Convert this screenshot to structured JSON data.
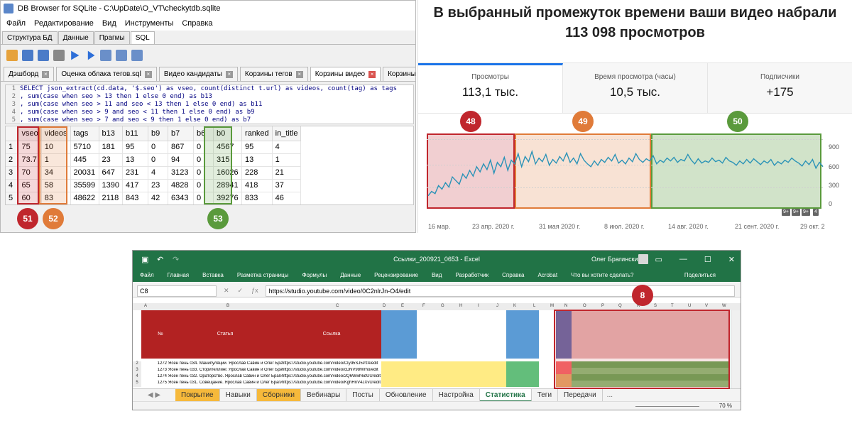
{
  "dbb": {
    "title": "DB Browser for SQLite - C:\\UpDate\\O_VT\\checkytdb.sqlite",
    "menu": [
      "Файл",
      "Редактирование",
      "Вид",
      "Инструменты",
      "Справка"
    ],
    "main_tabs": [
      "Структура БД",
      "Данные",
      "Прагмы",
      "SQL"
    ],
    "active_main_tab": "SQL",
    "sub_tabs": [
      {
        "label": "Дэшборд",
        "x_color": "gray"
      },
      {
        "label": "Оценка облака тегов.sql",
        "x_color": "gray"
      },
      {
        "label": "Видео кандидаты",
        "x_color": "gray"
      },
      {
        "label": "Корзины тегов",
        "x_color": "gray"
      },
      {
        "label": "Корзины видео",
        "x_color": "red"
      },
      {
        "label": "Корзины тегов видео",
        "x_color": "gray"
      }
    ],
    "sql_lines": [
      {
        "n": "1",
        "text": "SELECT json_extract(cd.data, '$.seo') as vseo, count(distinct t.url) as videos, count(tag) as tags"
      },
      {
        "n": "2",
        "text": ", sum(case when seo > 13 then 1 else 0 end) as b13"
      },
      {
        "n": "3",
        "text": ", sum(case when seo > 11 and seo < 13 then 1 else 0 end) as b11"
      },
      {
        "n": "4",
        "text": ", sum(case when seo > 9 and seo < 11 then 1 else 0 end) as b9"
      },
      {
        "n": "5",
        "text": ", sum(case when seo > 7 and seo < 9 then 1 else 0 end) as b7"
      }
    ],
    "grid": {
      "columns": [
        "vseo",
        "videos",
        "tags",
        "b13",
        "b11",
        "b9",
        "b7",
        "b6",
        "b0",
        "ranked",
        "in_title"
      ],
      "rows": [
        [
          "1",
          "75",
          "10",
          "5710",
          "181",
          "95",
          "0",
          "867",
          "0",
          "4567",
          "95",
          "4"
        ],
        [
          "2",
          "73.7",
          "1",
          "445",
          "23",
          "13",
          "0",
          "94",
          "0",
          "315",
          "13",
          "1"
        ],
        [
          "3",
          "70",
          "34",
          "20031",
          "647",
          "231",
          "4",
          "3123",
          "0",
          "16026",
          "228",
          "21"
        ],
        [
          "4",
          "65",
          "58",
          "35599",
          "1390",
          "417",
          "23",
          "4828",
          "0",
          "28941",
          "418",
          "37"
        ],
        [
          "5",
          "60",
          "83",
          "48622",
          "2118",
          "843",
          "42",
          "6343",
          "0",
          "39276",
          "833",
          "46"
        ]
      ]
    },
    "badges": [
      {
        "label": "51",
        "color": "#c0262d"
      },
      {
        "label": "52",
        "color": "#e07b39"
      },
      {
        "label": "53",
        "color": "#5a9a3c"
      }
    ]
  },
  "yt": {
    "headline_1": "В выбранный промежуток времени ваши видео набрали",
    "headline_2": "113 098 просмотров",
    "metrics": [
      {
        "label": "Просмотры",
        "value": "113,1 тыс."
      },
      {
        "label": "Время просмотра (часы)",
        "value": "10,5 тыс."
      },
      {
        "label": "Подписчики",
        "value": "+175"
      }
    ],
    "badges": [
      {
        "label": "48",
        "color": "#c0262d"
      },
      {
        "label": "49",
        "color": "#e07b39"
      },
      {
        "label": "50",
        "color": "#5a9a3c"
      }
    ],
    "chart_data": {
      "type": "line",
      "x": [
        "16 мар.",
        "23 апр. 2020 г.",
        "31 мая 2020 г.",
        "8 июл. 2020 г.",
        "14 авг. 2020 г.",
        "21 сент. 2020 г.",
        "29 окт. 2"
      ],
      "yticks": [
        "900",
        "600",
        "300",
        "0"
      ],
      "ylim": [
        0,
        900
      ],
      "series_color": "#2b93b7",
      "values": [
        120,
        180,
        150,
        260,
        210,
        300,
        240,
        380,
        330,
        280,
        420,
        360,
        470,
        390,
        520,
        450,
        560,
        480,
        610,
        430,
        580,
        520,
        650,
        470,
        610,
        560,
        700,
        520,
        660,
        590,
        730,
        560,
        640,
        590,
        690,
        540,
        620,
        570,
        660,
        600,
        710,
        580,
        640,
        560,
        700,
        610,
        560,
        520,
        600,
        540,
        620,
        580,
        650,
        600,
        690,
        570,
        610,
        560,
        640,
        590,
        700,
        620,
        580,
        630,
        600,
        670,
        560,
        610,
        580,
        640,
        600,
        650,
        580,
        620,
        600,
        690,
        610,
        560,
        630,
        570,
        600,
        580,
        640,
        590,
        610,
        570,
        650,
        600,
        580,
        540,
        600,
        560,
        620,
        570,
        630,
        590,
        550,
        600,
        570,
        620,
        540,
        590,
        560,
        610,
        580,
        640,
        600,
        570,
        530,
        600,
        550,
        620,
        500,
        580,
        520
      ]
    },
    "mini_badges": [
      "9+",
      "9+",
      "9+",
      "4"
    ]
  },
  "xl": {
    "title": "Ссылки_200921_0653 - Excel",
    "user": "Олег Брагинский",
    "ribbon": [
      "Файл",
      "Главная",
      "Вставка",
      "Разметка страницы",
      "Формулы",
      "Данные",
      "Рецензирование",
      "Вид",
      "Разработчик",
      "Справка",
      "Acrobat",
      "Что вы хотите сделать?"
    ],
    "share": "Поделиться",
    "namebox": "C8",
    "formula": "https://studio.youtube.com/video/0C2nlrJn-O4/edit",
    "headers": [
      "№",
      "Статья",
      "Ссылка"
    ],
    "rows": [
      [
        "1272",
        "Ясен пень 034. Манипуляции. Ярослав Савин и Олег Брагинский",
        "https://studio.youtube.com/video/CIyd5SJ5Pz4/edit"
      ],
      [
        "1273",
        "Ясен пень 033. Сторителлинг. Ярослав Савин и Олег Брагинский",
        "https://studio.youtube.com/video/cDNV98Wrho/edit"
      ],
      [
        "1274",
        "Ясен пень 032. Ораторство. Ярослав Савин и Олег Брагинский",
        "https://studio.youtube.com/video/2Q6Wwh6dUU/edit"
      ],
      [
        "1275",
        "Ясен пень 031. Совещание. Ярослав Савин и Олег Брагинский",
        "https://studio.youtube.com/video/KghHnV4JXvU/edit"
      ]
    ],
    "sheet_tabs": [
      {
        "label": "Покрытие",
        "style": "orange"
      },
      {
        "label": "Навыки",
        "style": ""
      },
      {
        "label": "Сборники",
        "style": "orange"
      },
      {
        "label": "Вебинары",
        "style": ""
      },
      {
        "label": "Посты",
        "style": ""
      },
      {
        "label": "Обновление",
        "style": ""
      },
      {
        "label": "Настройка",
        "style": ""
      },
      {
        "label": "Статистика",
        "style": "active"
      },
      {
        "label": "Теги",
        "style": ""
      },
      {
        "label": "Передачи",
        "style": ""
      }
    ],
    "zoom": "70 %",
    "badge": {
      "label": "8",
      "color": "#c0262d"
    },
    "colors": {
      "header_red": "#b22222",
      "col_blue": "#5b9bd5",
      "cell_yellow": "#ffeb84",
      "cell_green": "#63be7b",
      "cell_red": "#f8696b",
      "region_pink": "#e8b4b4",
      "dark_band": "#6b6ba8"
    }
  }
}
